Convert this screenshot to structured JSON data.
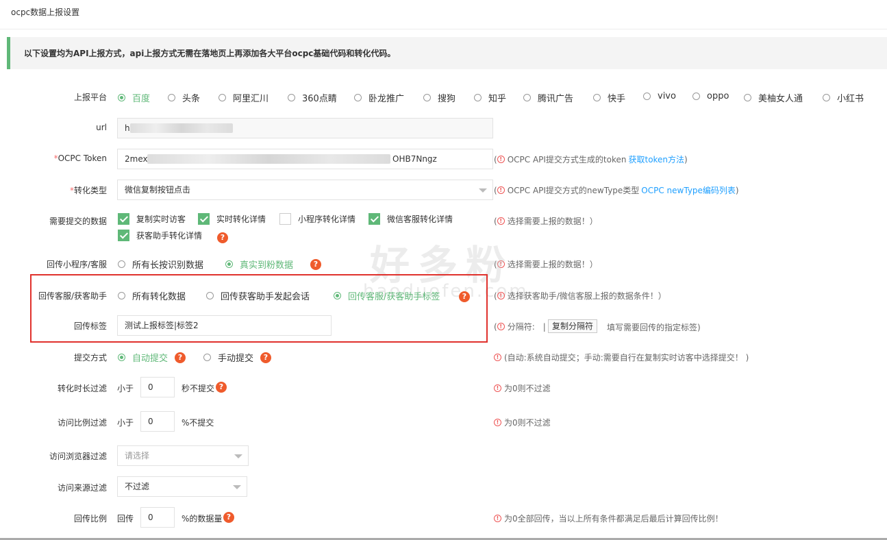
{
  "page_title": "ocpc数据上报设置",
  "notice": "以下设置均为API上报方式，api上报方式无需在落地页上再添加各大平台ocpc基础代码和转化代码。",
  "platform": {
    "label": "上报平台",
    "options": [
      "百度",
      "头条",
      "阿里汇川",
      "360点睛",
      "卧龙推广",
      "搜狗",
      "知乎",
      "腾讯广告",
      "快手",
      "vivo",
      "oppo",
      "美柚女人通",
      "小红书"
    ],
    "selected": "百度"
  },
  "url": {
    "label": "url",
    "value": "h"
  },
  "token": {
    "label": "OCPC Token",
    "required_mark": "*",
    "value_start": "2mexf",
    "value_end": "OHB7Nngz",
    "hint": "OCPC API提交方式生成的token",
    "link": "获取token方法"
  },
  "convert_type": {
    "label": "转化类型",
    "required_mark": "*",
    "value": "微信复制按钮点击",
    "hint": "OCPC API提交方式的newType类型",
    "link": "OCPC newType编码列表"
  },
  "submit_data": {
    "label": "需要提交的数据",
    "items": [
      {
        "label": "复制实时访客",
        "checked": true
      },
      {
        "label": "实时转化详情",
        "checked": true
      },
      {
        "label": "小程序转化详情",
        "checked": false
      },
      {
        "label": "微信客服转化详情",
        "checked": true
      },
      {
        "label": "获客助手转化详情",
        "checked": true
      }
    ],
    "hint": "选择需要上报的数据！）"
  },
  "mini_callback": {
    "label": "回传小程序/客服",
    "options": [
      "所有长按识别数据",
      "真实到粉数据"
    ],
    "selected": "真实到粉数据",
    "hint": "选择需要上报的数据！）"
  },
  "service_callback": {
    "label": "回传客服/获客助手",
    "options": [
      "所有转化数据",
      "回传获客助手发起会话",
      "回传客服/获客助手标签"
    ],
    "selected": "回传客服/获客助手标签",
    "hint": "选择获客助手/微信客服上报的数据条件！）"
  },
  "callback_tag": {
    "label": "回传标签",
    "value": "测试上报标签|标签2",
    "hint_prefix": "分隔符:",
    "separator": "|",
    "button": "复制分隔符",
    "hint_suffix": "填写需要回传的指定标签)"
  },
  "submit_mode": {
    "label": "提交方式",
    "options": [
      "自动提交",
      "手动提交"
    ],
    "selected": "自动提交",
    "hint": "(自动:系统自动提交；手动:需要自行在复制实时访客中选择提交！ )"
  },
  "duration_filter": {
    "label": "转化时长过滤",
    "prefix": "小于",
    "value": "0",
    "suffix": "秒不提交",
    "hint": "为0则不过滤"
  },
  "ratio_filter": {
    "label": "访问比例过滤",
    "prefix": "小于",
    "value": "0",
    "suffix": "%不提交",
    "hint": "为0则不过滤"
  },
  "browser_filter": {
    "label": "访问浏览器过滤",
    "placeholder": "请选择"
  },
  "source_filter": {
    "label": "访问来源过滤",
    "value": "不过滤"
  },
  "callback_ratio": {
    "label": "回传比例",
    "prefix": "回传",
    "value": "0",
    "suffix": "%的数据量",
    "hint": "为0全部回传，当以上所有条件都满足后最后计算回传比例！"
  },
  "watermark": {
    "text": "好多粉",
    "sub": "haoduofen.com"
  },
  "colors": {
    "accent": "#5fb878",
    "link": "#1e9fff",
    "required": "#f56c6c",
    "help": "#ef5b2c",
    "highlight_box": "#e0312c"
  }
}
